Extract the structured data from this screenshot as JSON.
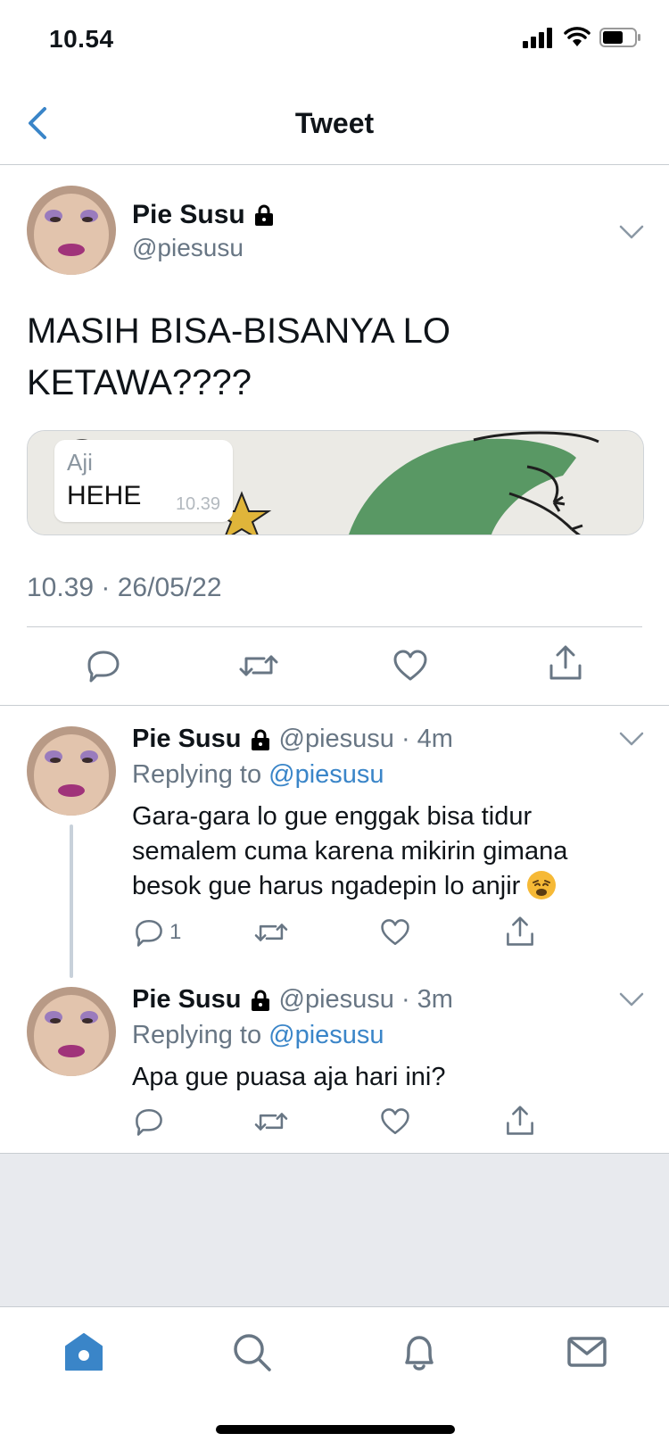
{
  "status_bar": {
    "time": "10.54"
  },
  "header": {
    "title": "Tweet"
  },
  "main_tweet": {
    "name": "Pie Susu",
    "handle": "@piesusu",
    "text": "MASIH BISA-BISANYA LO KETAWA????",
    "media": {
      "chat_name": "Aji",
      "chat_message": "HEHE",
      "chat_time": "10.39"
    },
    "timestamp": "10.39 · 26/05/22"
  },
  "replies": [
    {
      "name": "Pie Susu",
      "handle_time": "@piesusu · 4m",
      "replying_prefix": "Replying to",
      "replying_to": "@piesusu",
      "text": "Gara-gara lo gue enggak bisa tidur semalem cuma karena mikirin gimana besok gue harus ngadepin lo anjir",
      "emoji": "weary-face-emoji",
      "reply_count": "1"
    },
    {
      "name": "Pie Susu",
      "handle_time": "@piesusu · 3m",
      "replying_prefix": "Replying to",
      "replying_to": "@piesusu",
      "text": "Apa gue puasa aja hari ini?"
    }
  ],
  "icons": [
    "back-chevron-icon",
    "lock-icon",
    "chevron-down-icon",
    "reply-icon",
    "retweet-icon",
    "like-icon",
    "share-icon",
    "home-icon",
    "search-icon",
    "notifications-icon",
    "messages-icon",
    "signal-icon",
    "wifi-icon",
    "battery-icon"
  ],
  "colors": {
    "accent": "#3a85c8",
    "secondary_text": "#687684",
    "divider": "#c8cdd1"
  }
}
